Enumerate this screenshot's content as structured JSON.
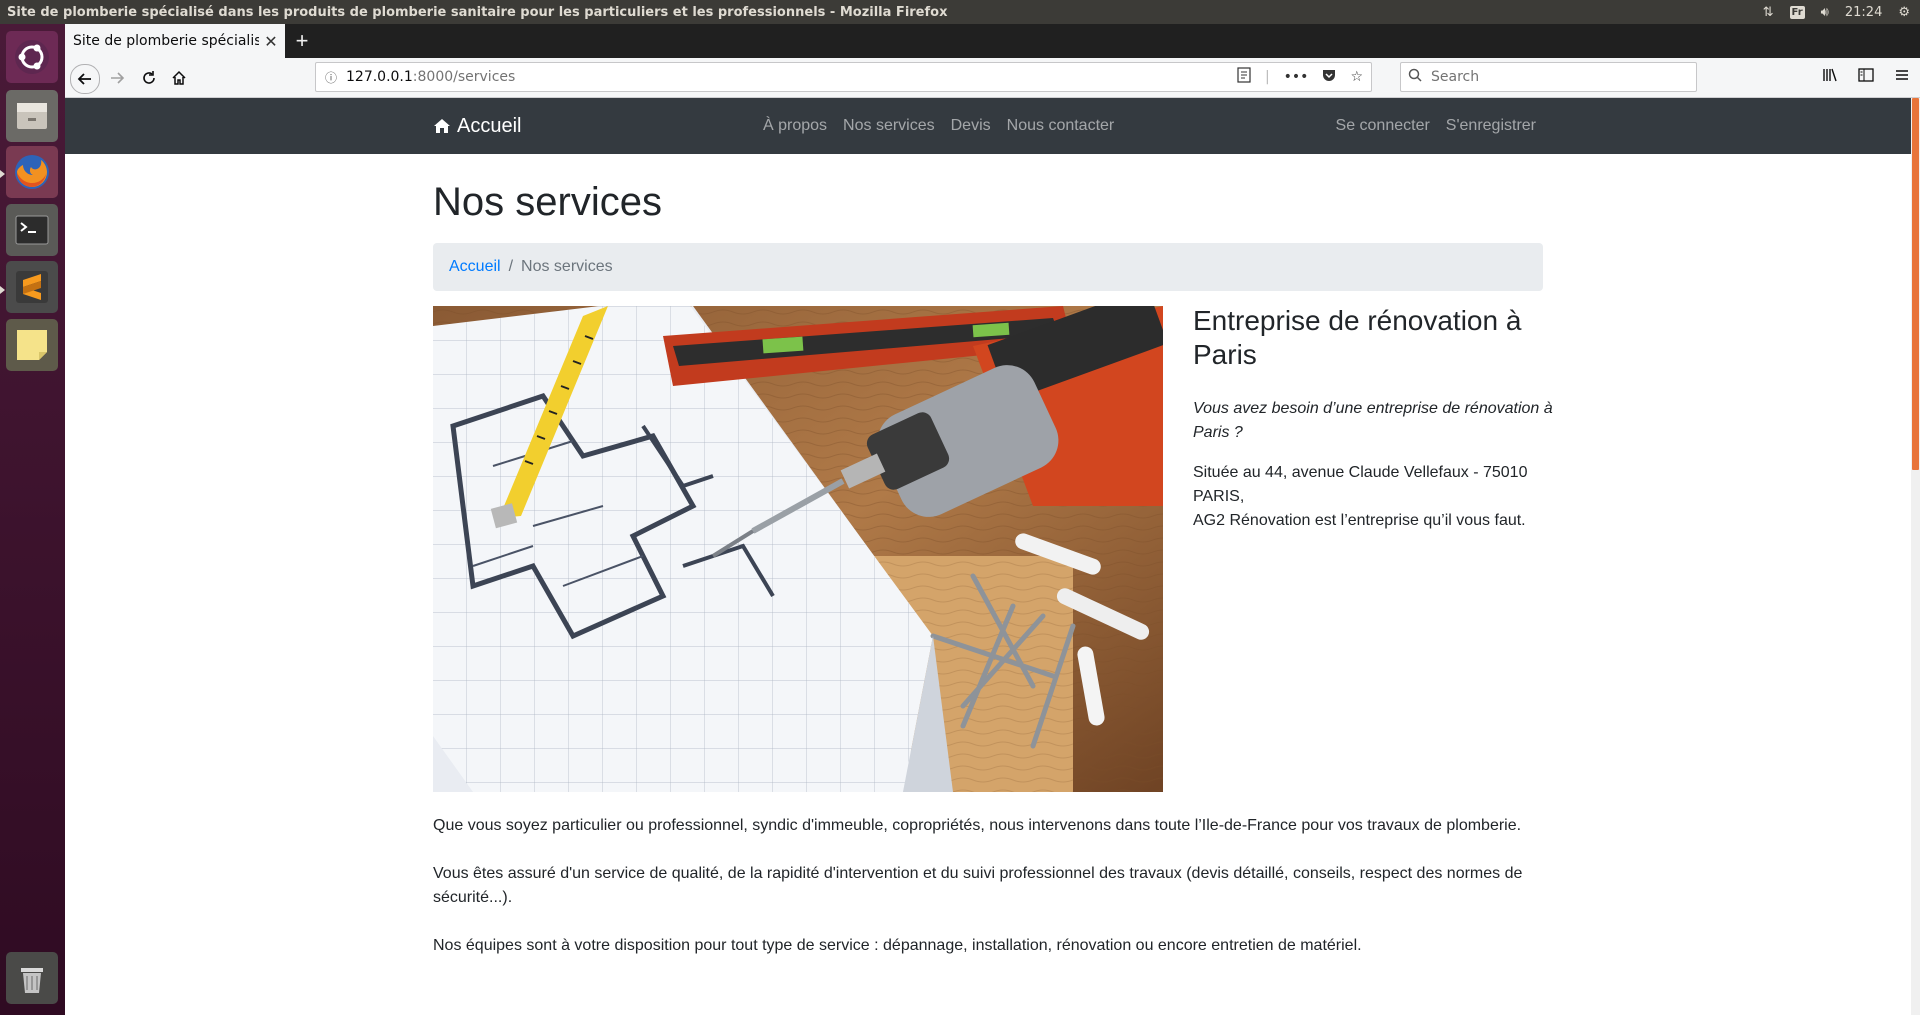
{
  "os": {
    "window_title": "Site de plomberie spécialisé dans les produits de plomberie sanitaire pour les particuliers et les professionnels - Mozilla Firefox",
    "keyboard_layout": "Fr",
    "clock": "21:24"
  },
  "launcher": {
    "items": [
      "ubuntu-icon",
      "files-icon",
      "firefox-icon",
      "terminal-icon",
      "sublime-text-icon",
      "notes-icon",
      "trash-icon"
    ]
  },
  "browser": {
    "tab_title": "Site de plomberie spécialisé",
    "url_host": "127.0.0.1",
    "url_path": ":8000/services",
    "search_placeholder": "Search"
  },
  "site": {
    "brand": "Accueil",
    "nav": [
      "À propos",
      "Nos services",
      "Devis",
      "Nous contacter"
    ],
    "auth": [
      "Se connecter",
      "S'enregistrer"
    ]
  },
  "page": {
    "title": "Nos services",
    "breadcrumb": {
      "home": "Accueil",
      "separator": "/",
      "current": "Nos services"
    },
    "side": {
      "heading": "Entreprise de rénovation à Paris",
      "question": "Vous avez besoin d’une entreprise de rénovation à Paris ?",
      "address_line": "Située au 44, avenue Claude Vellefaux - 75010 PARIS,",
      "company_line": "AG2 Rénovation est l’entreprise qu’il vous faut."
    },
    "paragraphs": [
      "Que vous soyez particulier ou professionnel, syndic d'immeuble, copropriétés, nous intervenons dans toute l’Ile-de-France pour vos travaux de plomberie.",
      "Vous êtes assuré d'un service de qualité, de la rapidité d'intervention et du suivi professionnel des travaux (devis détaillé, conseils, respect des normes de sécurité...).",
      "Nos équipes sont à votre disposition pour tout type de service : dépannage, installation, rénovation ou encore entretien de matériel."
    ]
  },
  "colors": {
    "navbar_bg": "#343a40",
    "link": "#007bff",
    "breadcrumb_bg": "#e9ecef",
    "launcher_bg": "#3b0f2a",
    "scroll_thumb": "#e8743a"
  }
}
